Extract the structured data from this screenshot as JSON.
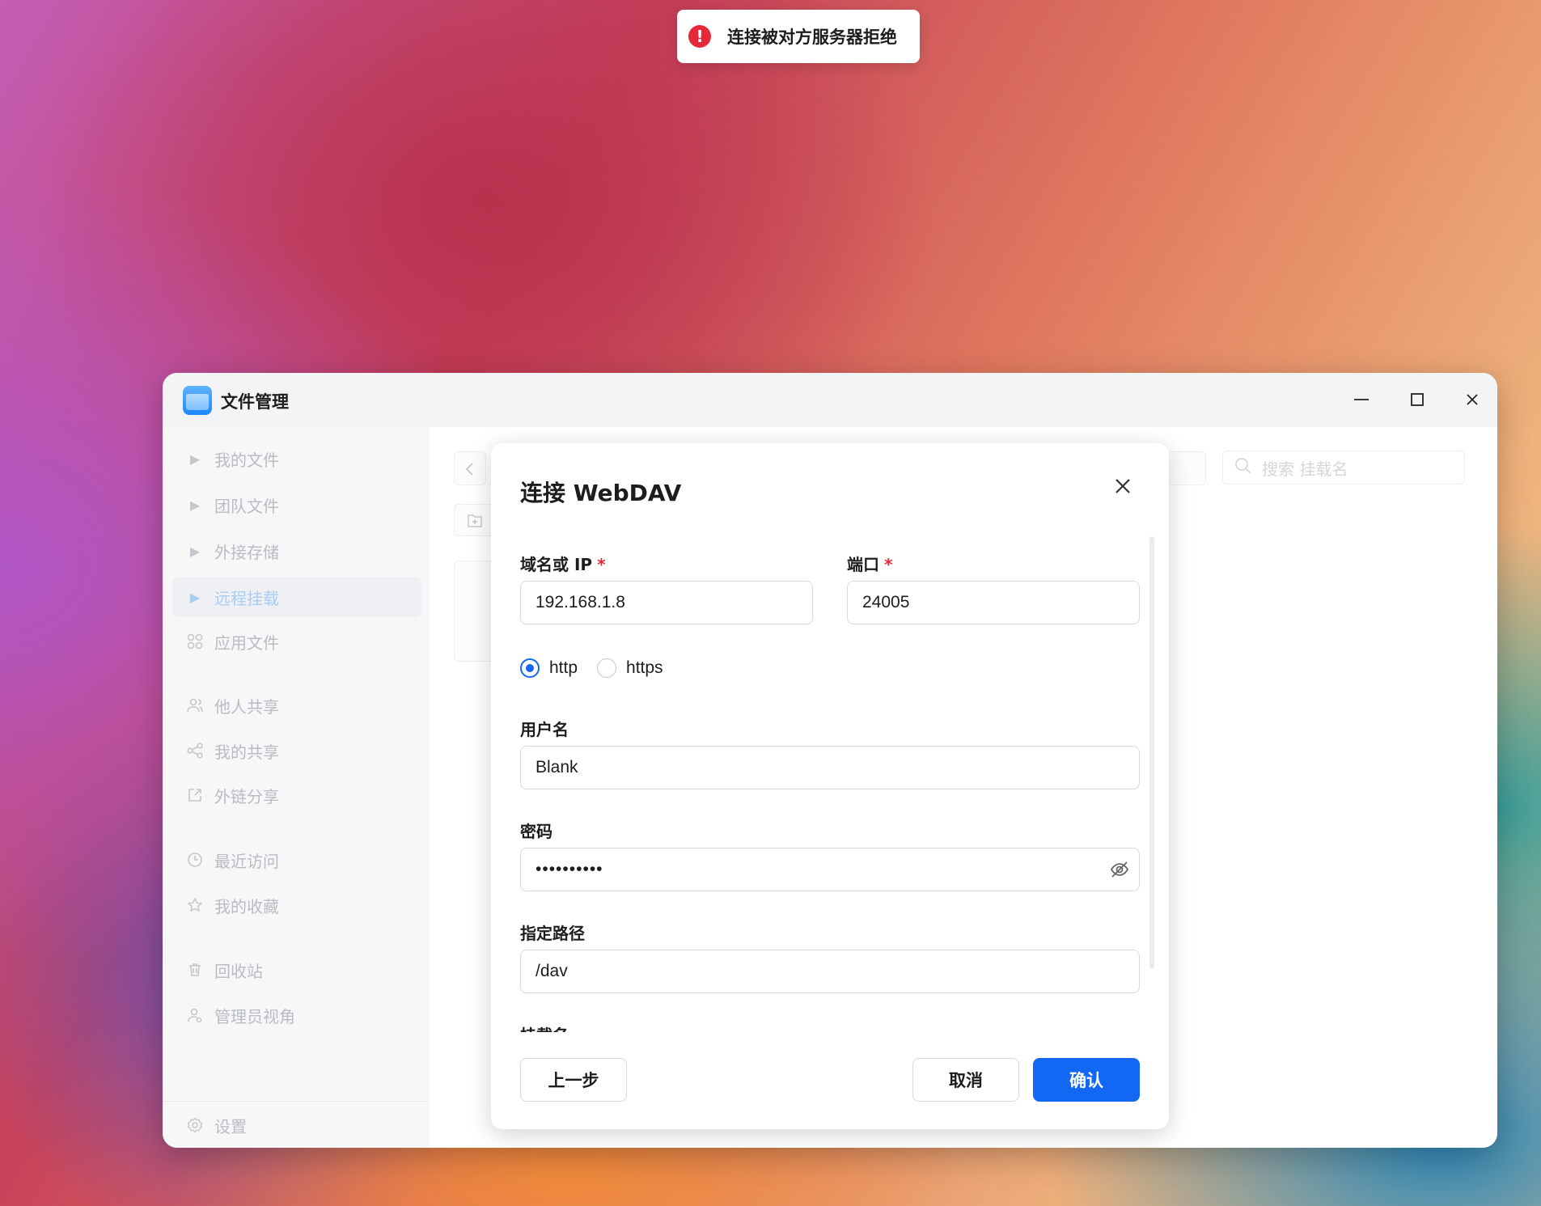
{
  "toast": {
    "message": "连接被对方服务器拒绝"
  },
  "window": {
    "title": "文件管理",
    "controls": {
      "minimize": "—",
      "maximize": "☐",
      "close": "✕"
    }
  },
  "sidebar": {
    "items": [
      {
        "label": "我的文件",
        "icon": "caret-right-icon"
      },
      {
        "label": "团队文件",
        "icon": "caret-right-icon"
      },
      {
        "label": "外接存储",
        "icon": "caret-right-icon"
      },
      {
        "label": "远程挂载",
        "icon": "caret-right-icon",
        "active": true
      },
      {
        "label": "应用文件",
        "icon": "apps-grid-icon"
      },
      {
        "label": "他人共享",
        "icon": "users-icon"
      },
      {
        "label": "我的共享",
        "icon": "share-icon"
      },
      {
        "label": "外链分享",
        "icon": "external-link-icon"
      },
      {
        "label": "最近访问",
        "icon": "clock-icon"
      },
      {
        "label": "我的收藏",
        "icon": "star-icon"
      },
      {
        "label": "回收站",
        "icon": "trash-icon"
      },
      {
        "label": "管理员视角",
        "icon": "admin-user-icon"
      }
    ],
    "settings": "设置"
  },
  "main": {
    "search_placeholder": "搜索 挂载名"
  },
  "dialog": {
    "title": "连接 WebDAV",
    "host": {
      "label": "域名或 IP",
      "required": "*",
      "value": "192.168.1.8"
    },
    "port": {
      "label": "端口",
      "required": "*",
      "value": "24005"
    },
    "protocol": {
      "options": [
        "http",
        "https"
      ],
      "selected": "http"
    },
    "username": {
      "label": "用户名",
      "value": "Blank"
    },
    "password": {
      "label": "密码",
      "value": "••••••••••"
    },
    "path": {
      "label": "指定路径",
      "value": "/dav"
    },
    "mount_name": {
      "label": "挂载名"
    },
    "buttons": {
      "prev": "上一步",
      "cancel": "取消",
      "confirm": "确认"
    }
  },
  "colors": {
    "primary": "#1268f3",
    "error": "#e5283a",
    "required": "#e5283a"
  }
}
